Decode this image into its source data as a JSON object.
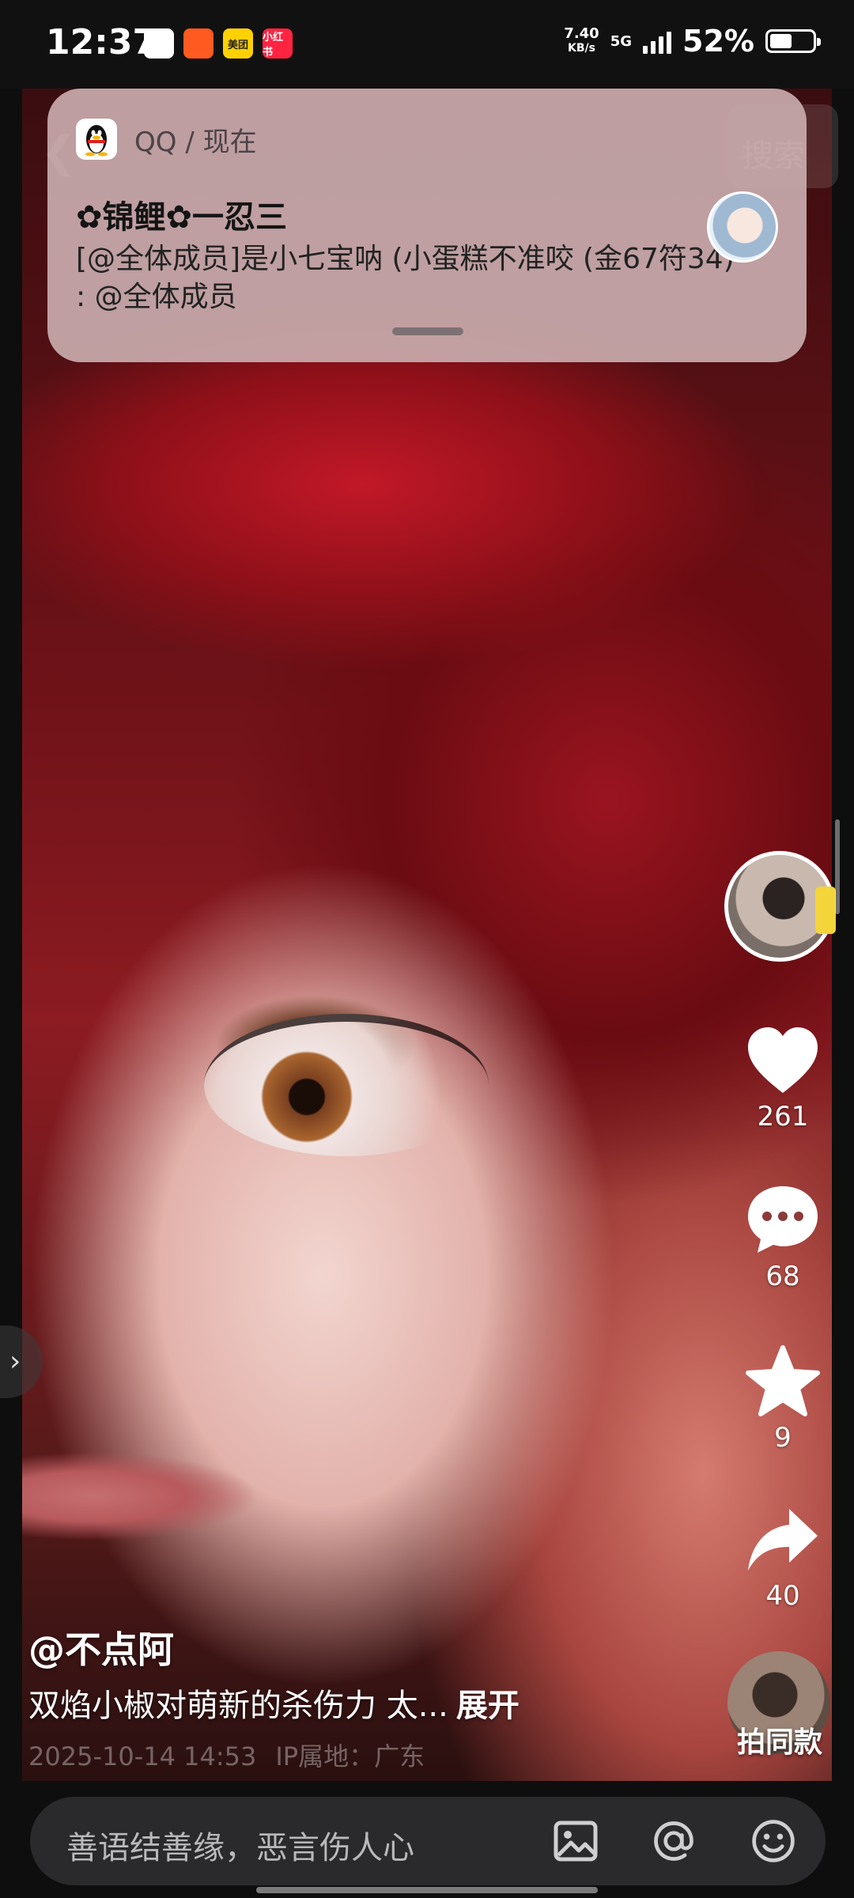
{
  "status_bar": {
    "time": "12:37",
    "apps": [
      {
        "name": "qq-app-icon",
        "label": "",
        "bg": "#ffffff",
        "color": "#000"
      },
      {
        "name": "taobao-app-icon",
        "label": "",
        "bg": "#ff5a1f",
        "color": "#fff"
      },
      {
        "name": "meituan-app-icon",
        "label": "美团",
        "bg": "#ffd100",
        "color": "#222"
      },
      {
        "name": "xiaohongshu-app-icon",
        "label": "小红书",
        "bg": "#ff2442",
        "color": "#fff"
      }
    ],
    "net_speed_value": "7.40",
    "net_speed_unit": "KB/s",
    "network": "5G",
    "battery_text": "52%",
    "battery_level": 0.52
  },
  "header": {
    "back_icon": "chevron-left-icon",
    "search_label": "搜索"
  },
  "notification": {
    "app": "QQ / 现在",
    "title": "✿锦鲤✿一忍三",
    "body": "[@全体成员]是小七宝呐 (小蛋糕不准咬 (金67符34) : @全体成员"
  },
  "actions": {
    "likes": "261",
    "comments": "68",
    "favorites": "9",
    "shares": "40"
  },
  "caption": {
    "author": "@不点阿",
    "description": "双焰小椒对萌新的杀伤力 太...",
    "expand": "展开",
    "date": "2025-10-14 14:53",
    "location": "IP属地：广东"
  },
  "same_style_label": "拍同款",
  "comment_bar": {
    "placeholder": "善语结善缘，恶言伤人心"
  },
  "colors": {
    "rail_icon": "#ffffff",
    "comment_bar_bg": "#2a2a2c"
  }
}
